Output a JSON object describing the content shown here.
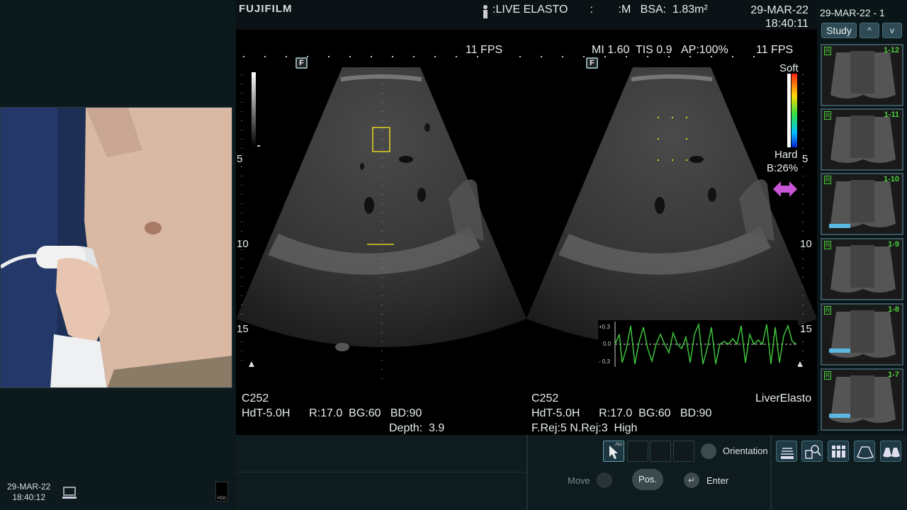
{
  "left": {
    "date": "29-MAR-22",
    "time": "18:40:12",
    "hdd_label": "HDD"
  },
  "header": {
    "brand": "FUJIFILM",
    "patient_line": ":LIVE ELASTO       :        :M   BSA:  1.83m²",
    "date": "29-MAR-22",
    "time": "18:40:11"
  },
  "image": {
    "fps_left": "11 FPS",
    "params_right": "MI 1.60  TIS 0.9   AP:100%",
    "fps_right": "11 FPS",
    "f_marker": "F",
    "depth_ticks": [
      "5",
      "10",
      "15"
    ],
    "scale_soft": "Soft",
    "scale_hard": "Hard",
    "scale_b": "B:26%",
    "scale_depth5": "5",
    "right_depth10": "10",
    "right_depth15": "15",
    "strain_ticks": [
      "+0.3",
      "0.0",
      "- 0.3"
    ],
    "left_info": {
      "probe": "C252",
      "line2": "HdT-5.0H      R:17.0  BG:60   BD:90",
      "line3": "Depth:  3.9"
    },
    "right_info": {
      "probe": "C252",
      "line2": "HdT-5.0H      R:17.0  BG:60   BD:90",
      "line3": "F.Rej:5 N.Rej:3  High",
      "mode": "LiverElasto"
    }
  },
  "study": {
    "date": "29-MAR-22 - 1",
    "button": "Study",
    "up": "^",
    "down": "v",
    "thumbnails": [
      {
        "label": "1-12",
        "r": "R"
      },
      {
        "label": "1-11",
        "r": "R"
      },
      {
        "label": "1-10",
        "r": "R"
      },
      {
        "label": "1-9",
        "r": "R"
      },
      {
        "label": "1-8",
        "r": "R"
      },
      {
        "label": "1-7",
        "r": "R"
      }
    ]
  },
  "controls": {
    "orientation": "Orientation",
    "move": "Move",
    "pos": "Pos.",
    "enter": "Enter",
    "cursor_text": "Abc"
  },
  "colors": {
    "accent_green": "#4cd03c",
    "roi_yellow": "#e6d21e",
    "strain_green": "#3ec23a",
    "arrow_magenta": "#c855d6"
  }
}
